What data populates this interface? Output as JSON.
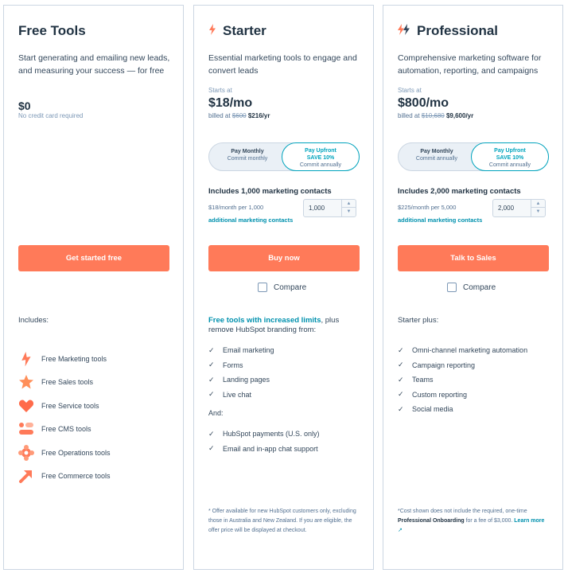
{
  "free": {
    "title": "Free Tools",
    "description": "Start generating and emailing new leads, and measuring your success — for free",
    "price": "$0",
    "price_note": "No credit card required",
    "cta": "Get started free",
    "includes_label": "Includes:",
    "tools": [
      {
        "label": "Free Marketing tools",
        "icon": "marketing-hub-icon"
      },
      {
        "label": "Free Sales tools",
        "icon": "sales-hub-icon"
      },
      {
        "label": "Free Service tools",
        "icon": "service-hub-icon"
      },
      {
        "label": "Free CMS tools",
        "icon": "cms-hub-icon"
      },
      {
        "label": "Free Operations tools",
        "icon": "operations-hub-icon"
      },
      {
        "label": "Free Commerce tools",
        "icon": "commerce-hub-icon"
      }
    ]
  },
  "starter": {
    "title": "Starter",
    "description": "Essential marketing tools to engage and convert leads",
    "starts_at": "Starts at",
    "price": "$18/mo",
    "billed_prefix": "billed at",
    "billed_old": "$600",
    "billed_new": "$216/yr",
    "toggle": {
      "left_title": "Pay Monthly",
      "left_sub": "Commit monthly",
      "right_title": "Pay Upfront",
      "right_save": "SAVE 10%",
      "right_sub": "Commit annually"
    },
    "contacts_title": "Includes 1,000 marketing contacts",
    "contacts_rate": "$18/month per 1,000",
    "contacts_link": "additional marketing contacts",
    "stepper_value": "1,000",
    "cta": "Buy now",
    "compare_label": "Compare",
    "includes_link": "Free tools with increased limits",
    "includes_rest": ", plus remove HubSpot branding from:",
    "features": [
      "Email marketing",
      "Forms",
      "Landing pages",
      "Live chat"
    ],
    "and_label": "And:",
    "features_extra": [
      "HubSpot payments (U.S. only)",
      "Email and in-app chat support"
    ],
    "footnote": "* Offer available for new HubSpot customers only, excluding those in Australia and New Zealand. If you are eligible, the offer price will be displayed at checkout."
  },
  "professional": {
    "title": "Professional",
    "description": "Comprehensive marketing software for automation, reporting, and campaigns",
    "starts_at": "Starts at",
    "price": "$800/mo",
    "billed_prefix": "billed at",
    "billed_old": "$10,680",
    "billed_new": "$9,600/yr",
    "toggle": {
      "left_title": "Pay Monthly",
      "left_sub": "Commit annually",
      "right_title": "Pay Upfront",
      "right_save": "SAVE 10%",
      "right_sub": "Commit annually"
    },
    "contacts_title": "Includes 2,000 marketing contacts",
    "contacts_rate": "$225/month per 5,000",
    "contacts_link": "additional marketing contacts",
    "stepper_value": "2,000",
    "cta": "Talk to Sales",
    "compare_label": "Compare",
    "includes_head": "Starter plus:",
    "features": [
      "Omni-channel marketing automation",
      "Campaign reporting",
      "Teams",
      "Custom reporting",
      "Social media"
    ],
    "footnote_pre": "*Cost shown does not include the required, one-time ",
    "footnote_bold": "Professional Onboarding",
    "footnote_mid": " for a fee of $3,000. ",
    "footnote_link": "Learn more"
  },
  "colors": {
    "accent": "#ff7a59",
    "teal": "#00a4bd",
    "text": "#33475b"
  }
}
